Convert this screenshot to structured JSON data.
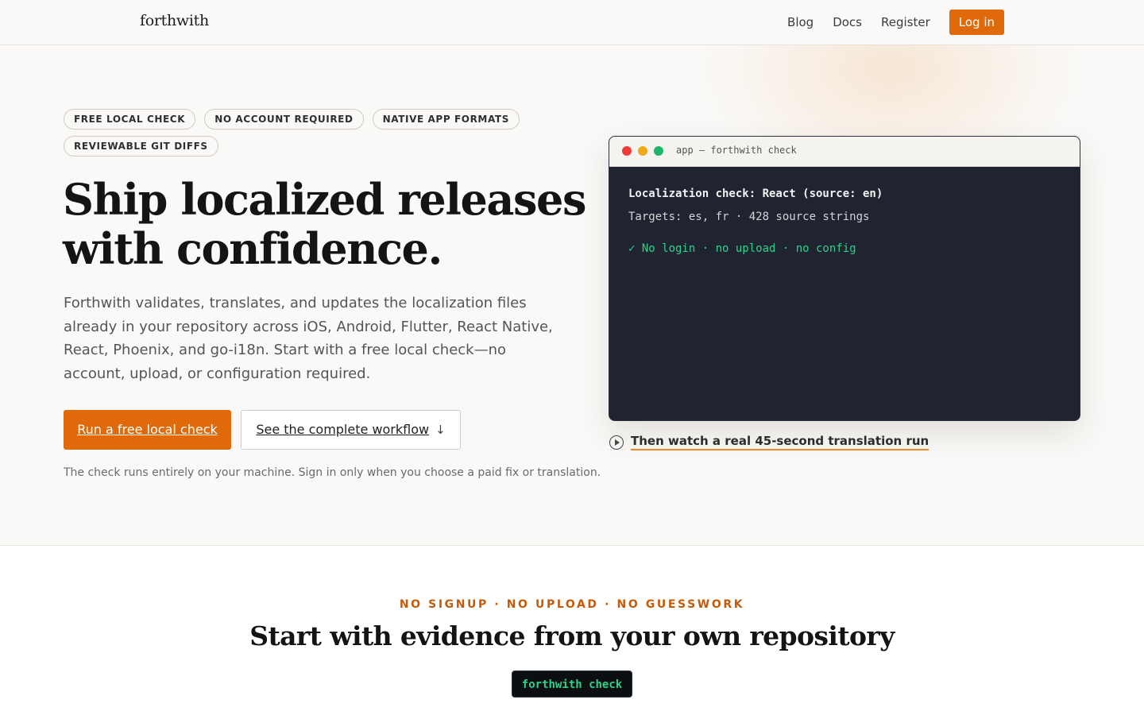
{
  "header": {
    "logo": "forthwith",
    "nav": [
      {
        "label": "Blog"
      },
      {
        "label": "Docs"
      },
      {
        "label": "Register"
      }
    ],
    "login_label": "Log in",
    "accent": "#e06a0a"
  },
  "hero": {
    "chips": [
      "FREE LOCAL CHECK",
      "NO ACCOUNT REQUIRED",
      "NATIVE APP FORMATS",
      "REVIEWABLE GIT DIFFS"
    ],
    "headline": "Ship localized releases with confidence.",
    "lede": "Forthwith validates, translates, and updates the localization files already in your repository across iOS, Android, Flutter, React Native, React, Phoenix, and go-i18n. Start with a free local check—no account, upload, or configuration required.",
    "primary_button": "Run a free local check",
    "secondary_button": "See the complete workflow",
    "secondary_icon": "arrow-down-icon",
    "note": "The check runs entirely on your machine. Sign in only when you choose a paid fix or translation."
  },
  "terminal": {
    "title": "app — forthwith check",
    "line1": "Localization check: React (source: en)",
    "line2": "Targets: es, fr · 428 source strings",
    "line3": "✓ No login · no upload · no config",
    "success_color": "#2ed18a"
  },
  "watch": {
    "icon": "play-circle-icon",
    "label": "Then watch a real 45-second translation run"
  },
  "lower": {
    "eyebrow": "NO SIGNUP · NO UPLOAD · NO GUESSWORK",
    "title": "Start with evidence from your own repository",
    "command": "forthwith check"
  }
}
